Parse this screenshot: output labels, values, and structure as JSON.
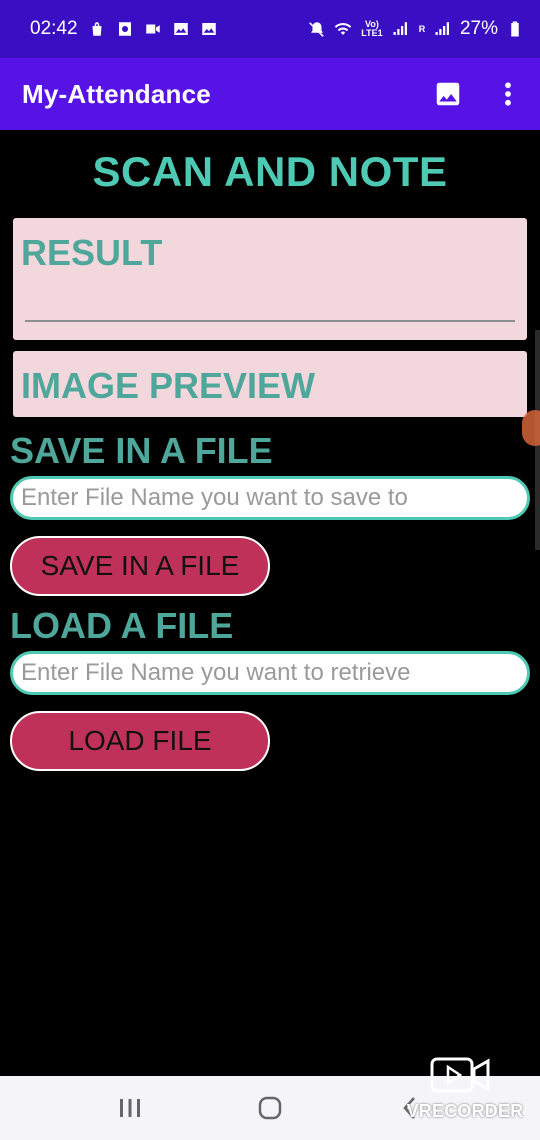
{
  "status_bar": {
    "time": "02:42",
    "battery": "27%",
    "network_label_top": "Vo)",
    "network_label_bottom": "LTE1",
    "signal_label": "R"
  },
  "app_bar": {
    "title": "My-Attendance"
  },
  "main": {
    "page_title": "SCAN AND NOTE",
    "result_label": "RESULT",
    "preview_label": "IMAGE PREVIEW",
    "save_section_label": "SAVE IN A FILE",
    "save_input_placeholder": "Enter File Name you want to save to",
    "save_input_value": "",
    "save_button_label": "SAVE IN A FILE",
    "load_section_label": "LOAD A FILE",
    "load_input_placeholder": "Enter File Name you want to retrieve",
    "load_input_value": "",
    "load_button_label": "LOAD FILE"
  },
  "watermark": {
    "text": "VRECORDER"
  },
  "colors": {
    "status_bar": "#3a0fc4",
    "app_bar": "#5713e6",
    "teal_heading": "#4ec9b3",
    "card_bg": "#f2d7dd",
    "card_label": "#4ea79a",
    "button_bg": "#c0315a"
  }
}
